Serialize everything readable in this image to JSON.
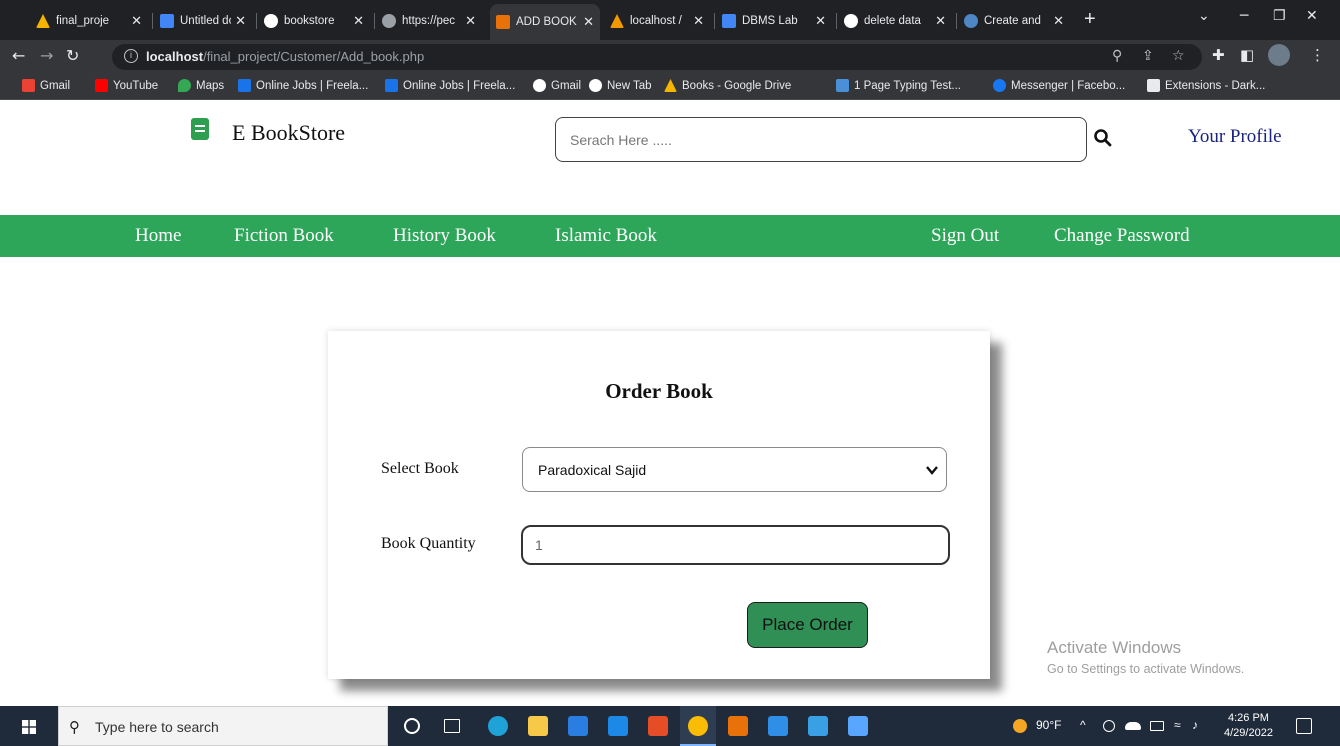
{
  "browser": {
    "tabs": [
      {
        "title": "final_proje",
        "color": "#f4b400"
      },
      {
        "title": "Untitled do",
        "color": "#4285f4"
      },
      {
        "title": "bookstore",
        "color": "#ffffff"
      },
      {
        "title": "https://pec",
        "color": "#9aa0a6"
      },
      {
        "title": "ADD BOOK",
        "color": "#e8710a"
      },
      {
        "title": "localhost /",
        "color": "#f29900"
      },
      {
        "title": "DBMS Lab",
        "color": "#4285f4"
      },
      {
        "title": "delete data",
        "color": "#ffffff"
      },
      {
        "title": "Create and",
        "color": "#4f86c6"
      }
    ],
    "active_tab_index": 4,
    "new_tab_label": "+",
    "url_host": "localhost",
    "url_path": "/final_project/Customer/Add_book.php",
    "bookmarks": [
      {
        "label": "Gmail",
        "color": "#ea4335"
      },
      {
        "label": "YouTube",
        "color": "#ff0000"
      },
      {
        "label": "Maps",
        "color": "#34a853"
      },
      {
        "label": "Online Jobs | Freela...",
        "color": "#1a73e8"
      },
      {
        "label": "Online Jobs | Freela...",
        "color": "#1a73e8"
      },
      {
        "label": "Gmail",
        "color": "#ffffff"
      },
      {
        "label": "New Tab",
        "color": "#ffffff"
      },
      {
        "label": "Books - Google Drive",
        "color": "#f4b400"
      },
      {
        "label": "1 Page Typing Test...",
        "color": "#4a90d9"
      },
      {
        "label": "Messenger | Facebo...",
        "color": "#1877f2"
      },
      {
        "label": "Extensions - Dark...",
        "color": "#e8eaed"
      }
    ]
  },
  "header": {
    "logo_text": "E BookStore",
    "search_placeholder": "Serach Here .....",
    "profile_link": "Your Profile"
  },
  "nav": {
    "home": "Home",
    "fiction": "Fiction Book",
    "history": "History Book",
    "islamic": "Islamic Book",
    "signout": "Sign Out",
    "change_password": "Change Password"
  },
  "order_form": {
    "title": "Order Book",
    "select_label": "Select Book",
    "selected_book": "Paradoxical Sajid",
    "quantity_label": "Book Quantity",
    "quantity_value": "1",
    "submit_label": "Place Order"
  },
  "watermark": {
    "line1": "Activate Windows",
    "line2": "Go to Settings to activate Windows."
  },
  "taskbar": {
    "search_placeholder": "Type here to search",
    "weather": "90°F",
    "time": "4:26 PM",
    "date": "4/29/2022"
  },
  "colors": {
    "nav_green": "#2ea65a",
    "button_green": "#2f8f55",
    "profile_blue": "#1a237e"
  }
}
